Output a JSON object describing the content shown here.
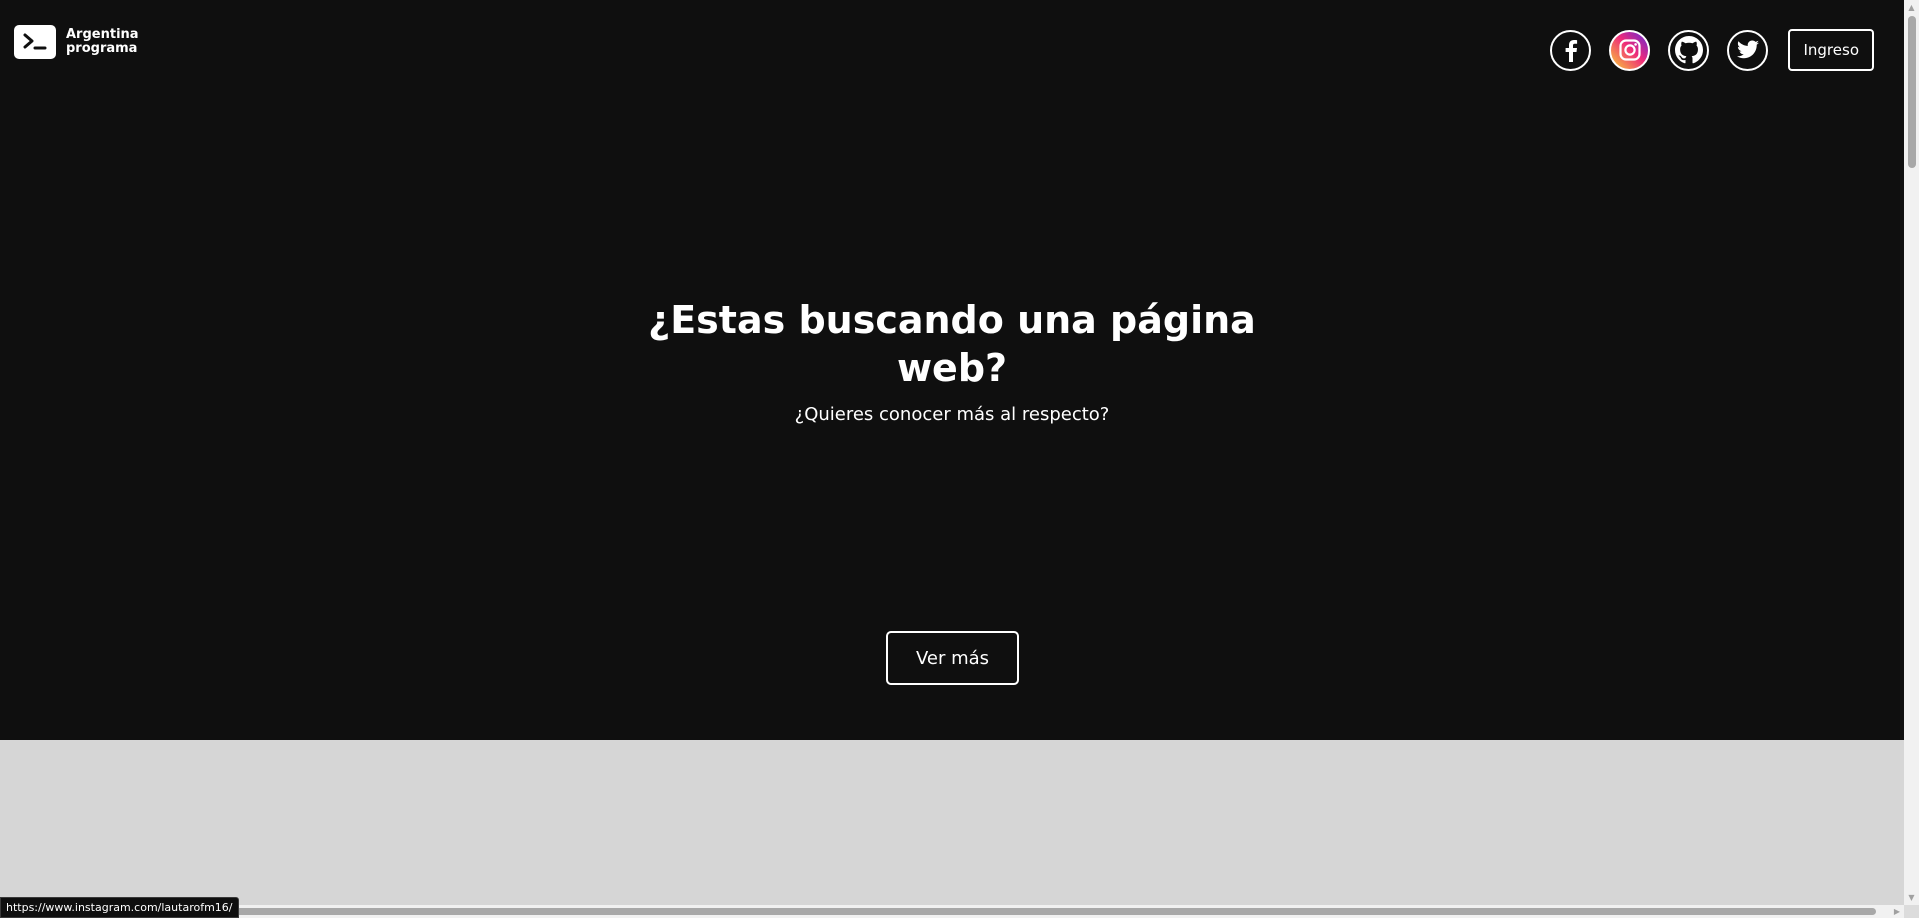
{
  "header": {
    "logo": {
      "line1": "Argentina",
      "line2": "programa",
      "icon": "terminal-prompt-icon"
    },
    "social_links": [
      {
        "name": "facebook",
        "icon": "facebook-icon"
      },
      {
        "name": "instagram",
        "icon": "instagram-icon"
      },
      {
        "name": "github",
        "icon": "github-icon"
      },
      {
        "name": "twitter",
        "icon": "twitter-icon"
      }
    ],
    "login_label": "Ingreso"
  },
  "hero": {
    "title_line1": "¿Estas buscando una página",
    "title_line2": "web?",
    "subtitle": "¿Quieres conocer más al respecto?",
    "cta_label": "Ver más"
  },
  "status_bar": {
    "hover_url": "https://www.instagram.com/lautarofm16/"
  },
  "colors": {
    "hero_background": "#0f0f0f",
    "section_background": "#d6d6d6",
    "text": "#ffffff",
    "instagram_gradient_start": "#f9ce34",
    "instagram_gradient_mid": "#ee2a7b",
    "instagram_gradient_end": "#6228d7"
  }
}
